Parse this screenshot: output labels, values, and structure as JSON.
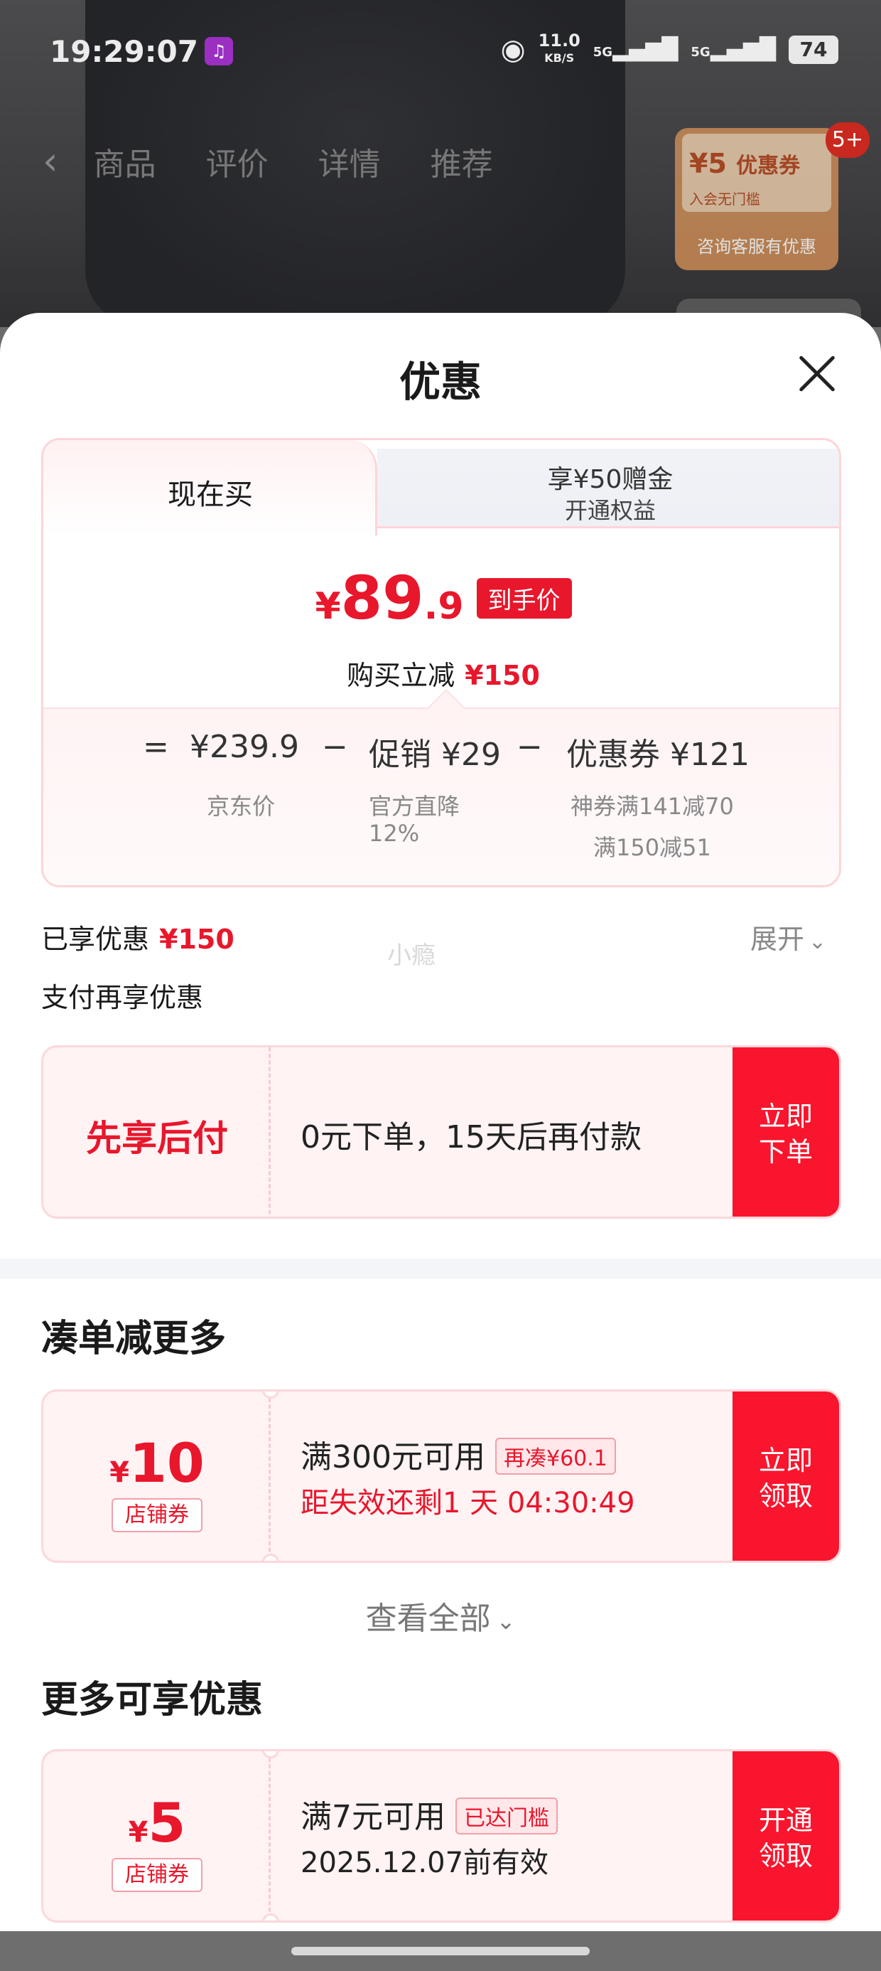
{
  "status_bar": {
    "time": "19:29:07",
    "net_speed": "11.0",
    "net_unit": "KB/S",
    "signal1": "5G",
    "signal2": "5G",
    "battery": "74"
  },
  "background": {
    "tabs": [
      "商品",
      "评价",
      "详情",
      "推荐"
    ],
    "coupon_amount": "¥5",
    "coupon_label": "优惠券",
    "coupon_sub": "入会无门槛",
    "coupon_cta": "咨询客服有优惠",
    "badge": "5+"
  },
  "sheet": {
    "title": "优惠",
    "tab_now": "现在买",
    "tab_other_line1": "享¥50赠金",
    "tab_other_line2": "开通权益",
    "price_yen": "¥",
    "price_int": "89",
    "price_dec": ".9",
    "price_tag": "到手价",
    "instant_reduce_label": "购买立减",
    "instant_reduce_value": "¥150",
    "breakdown": {
      "eq": "=",
      "jd_price": "¥239.9",
      "jd_price_label": "京东价",
      "minus1": "−",
      "promo": "促销 ¥29",
      "promo_sub1": "官方直降",
      "promo_sub2": "12%",
      "minus2": "−",
      "coupon": "优惠券 ¥121",
      "coupon_sub1": "神券满141减70",
      "coupon_sub2": "满150减51"
    },
    "enjoyed_label": "已享优惠",
    "enjoyed_value": "¥150",
    "expand": "展开",
    "watermark": "小瘾",
    "pay_more": "支付再享优惠",
    "bnpl": {
      "label": "先享后付",
      "text": "0元下单，15天后再付款",
      "cta_line1": "立即",
      "cta_line2": "下单"
    },
    "section1_title": "凑单减更多",
    "coupon1": {
      "yen": "¥",
      "amount": "10",
      "tag": "店铺券",
      "condition": "满300元可用",
      "pill": "再凑¥60.1",
      "expiry": "距失效还剩1 天 04:30:49",
      "cta_line1": "立即",
      "cta_line2": "领取"
    },
    "view_all": "查看全部",
    "section2_title": "更多可享优惠",
    "coupon2": {
      "yen": "¥",
      "amount": "5",
      "tag": "店铺券",
      "condition": "满7元可用",
      "pill": "已达门槛",
      "expiry": "2025.12.07前有效",
      "cta_line1": "开通",
      "cta_line2": "领取"
    }
  },
  "colors": {
    "accent_red": "#e8172c",
    "cta_red": "#f9152d",
    "card_border": "#fcd5d9"
  }
}
